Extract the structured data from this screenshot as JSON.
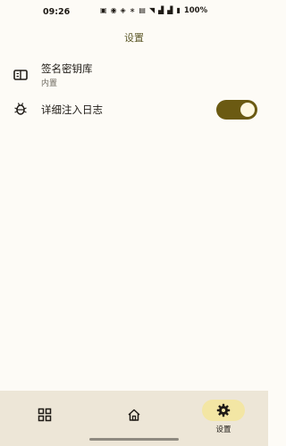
{
  "status_bar": {
    "time": "09:26",
    "icons": [
      "nfc-icon",
      "vpn-icon",
      "app-icon",
      "bluetooth-icon",
      "vibrate-icon",
      "wifi-icon",
      "signal-icon",
      "signal-icon",
      "battery-icon"
    ],
    "battery": "100%"
  },
  "header": {
    "title": "设置"
  },
  "settings": {
    "keystore": {
      "title": "签名密钥库",
      "subtitle": "内置"
    },
    "log": {
      "title": "详细注入日志",
      "enabled": true
    }
  },
  "nav": {
    "items": [
      {
        "icon": "grid-icon",
        "label": ""
      },
      {
        "icon": "home-icon",
        "label": ""
      },
      {
        "icon": "gear-icon",
        "label": "设置",
        "active": true
      }
    ]
  },
  "colors": {
    "background": "#fdfbf6",
    "accent": "#6b5a12",
    "title": "#5e5a2a",
    "nav_background": "#ede6d7",
    "nav_active_pill": "#f3e6a4"
  }
}
